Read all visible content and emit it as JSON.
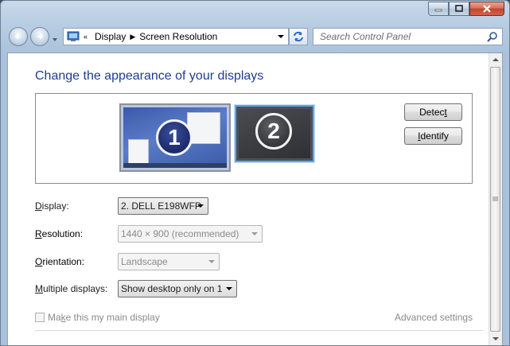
{
  "window": {
    "caption_buttons": {
      "minimize": "minimize-icon",
      "maximize": "maximize-icon",
      "close": "close-icon"
    }
  },
  "nav": {
    "breadcrumb": [
      "Display",
      "Screen Resolution"
    ],
    "search_placeholder": "Search Control Panel"
  },
  "main": {
    "title": "Change the appearance of your displays",
    "monitors": [
      {
        "number": "1",
        "selected": false
      },
      {
        "number": "2",
        "selected": true
      }
    ],
    "buttons": {
      "detect": {
        "pre": "Detec",
        "acc": "t",
        "post": ""
      },
      "identify": {
        "pre": "",
        "acc": "I",
        "post": "dentify"
      }
    },
    "fields": {
      "display": {
        "label_acc": "D",
        "label_rest": "isplay:",
        "value": "2. DELL E198WFP"
      },
      "resolution": {
        "label_acc": "R",
        "label_rest": "esolution:",
        "value": "1440 × 900 (recommended)"
      },
      "orientation": {
        "label_acc": "O",
        "label_rest": "rientation:",
        "value": "Landscape"
      },
      "multiple_displays": {
        "label_acc": "M",
        "label_rest": "ultiple displays:",
        "value": "Show desktop only on 1"
      }
    },
    "main_display_checkbox": {
      "label_pre": "Ma",
      "label_acc": "k",
      "label_post": "e this my main display",
      "checked": false
    },
    "advanced_link": "Advanced settings"
  },
  "colors": {
    "title": "#1e3e8a",
    "selected_monitor_border": "#5fa6e8"
  }
}
